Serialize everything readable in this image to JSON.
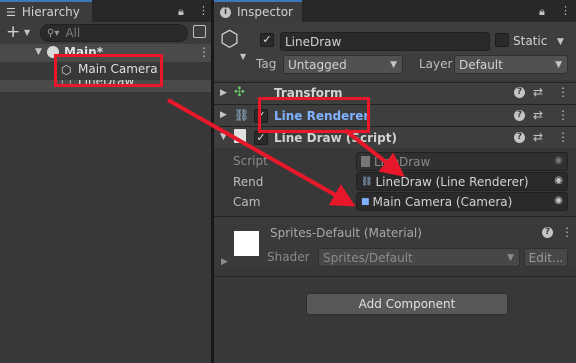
{
  "hierarchy": {
    "tab_label": "Hierarchy",
    "add_label": "+",
    "search_placeholder": "All",
    "scene_name": "Main*",
    "items": [
      {
        "label": "Main Camera"
      },
      {
        "label": "LineDraw"
      }
    ]
  },
  "inspector": {
    "tab_label": "Inspector",
    "object_name": "LineDraw",
    "static_label": "Static",
    "tag_label": "Tag",
    "tag_value": "Untagged",
    "layer_label": "Layer",
    "layer_value": "Default",
    "components": [
      {
        "name": "Transform"
      },
      {
        "name": "Line Renderer"
      },
      {
        "name": "Line Draw (Script)"
      }
    ],
    "script_fields": [
      {
        "label": "Script",
        "value": "LineDraw"
      },
      {
        "label": "Rend",
        "value": "LineDraw (Line Renderer)"
      },
      {
        "label": "Cam",
        "value": "Main Camera (Camera)"
      }
    ],
    "material": {
      "name": "Sprites-Default (Material)",
      "shader_label": "Shader",
      "shader_value": "Sprites/Default",
      "edit_label": "Edit..."
    },
    "add_component_label": "Add Component"
  },
  "colors": {
    "highlight": "#e8182a",
    "accent": "#3a79bb",
    "selected_text": "#7fb2ff"
  }
}
